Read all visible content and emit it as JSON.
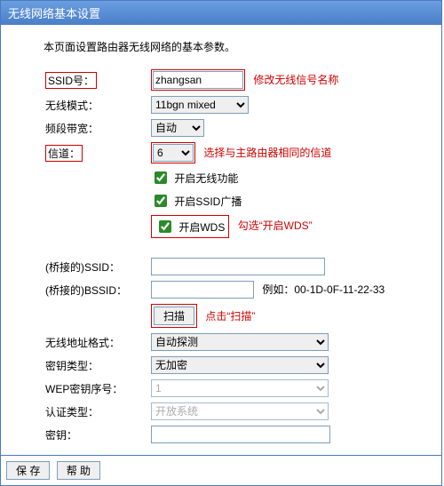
{
  "window_title": "无线网络基本设置",
  "intro": "本页面设置路由器无线网络的基本参数。",
  "ssid_label": "SSID号：",
  "ssid_value": "zhangsan",
  "ssid_annot": "修改无线信号名称",
  "mode_label": "无线模式：",
  "mode_value": "11bgn mixed",
  "bw_label": "频段带宽：",
  "bw_value": "自动",
  "chan_label": "信道：",
  "chan_value": "6",
  "chan_annot": "选择与主路由器相同的信道",
  "cb1_label": "开启无线功能",
  "cb2_label": "开启SSID广播",
  "cb3_label": "开启WDS",
  "cb3_annot": "勾选“开启WDS”",
  "bssid_label": "(桥接的)SSID：",
  "bssid_value": "",
  "bmac_label": "(桥接的)BSSID：",
  "bmac_value": "",
  "bmac_example": "例如：00-1D-0F-11-22-33",
  "scan_label": "扫描",
  "scan_annot": "点击“扫描”",
  "addrfmt_label": "无线地址格式：",
  "addrfmt_value": "自动探测",
  "keytype_label": "密钥类型：",
  "keytype_value": "无加密",
  "wepidx_label": "WEP密钥序号：",
  "wepidx_value": "1",
  "auth_label": "认证类型：",
  "auth_value": "开放系统",
  "key_label": "密钥：",
  "key_value": "",
  "save_label": "保 存",
  "help_label": "帮 助"
}
